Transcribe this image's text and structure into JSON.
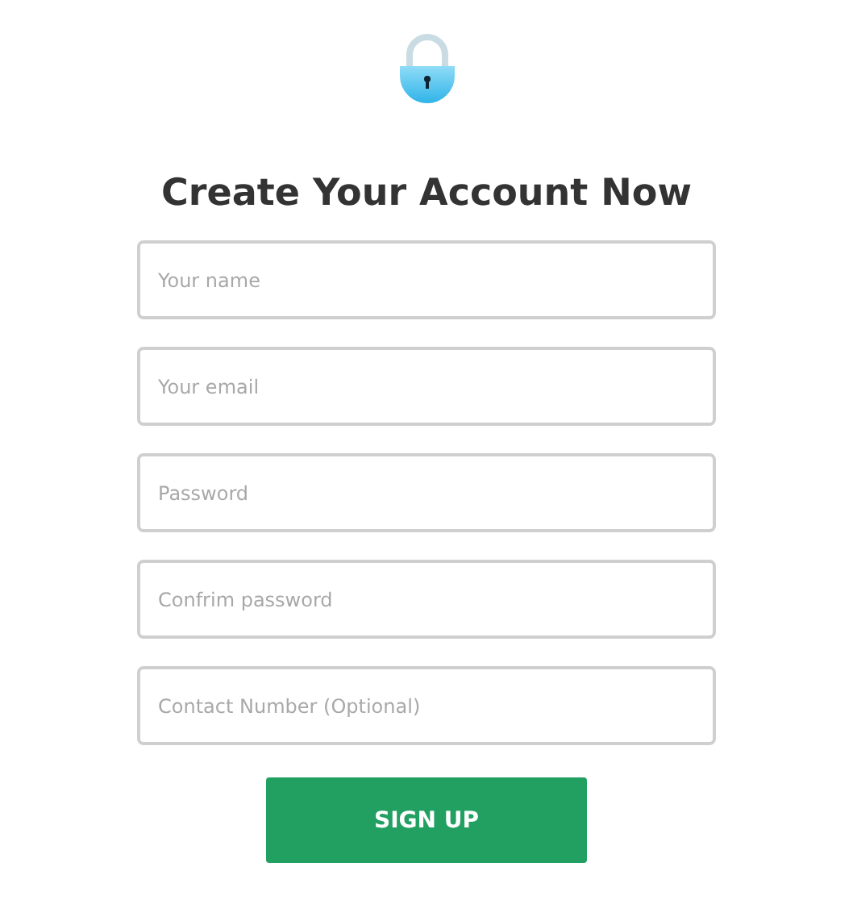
{
  "title": "Create Your Account Now",
  "fields": [
    {
      "placeholder": "Your name"
    },
    {
      "placeholder": "Your email"
    },
    {
      "placeholder": "Password"
    },
    {
      "placeholder": "Confrim password"
    },
    {
      "placeholder": "Contact Number (Optional)"
    }
  ],
  "submit": "SIGN UP"
}
